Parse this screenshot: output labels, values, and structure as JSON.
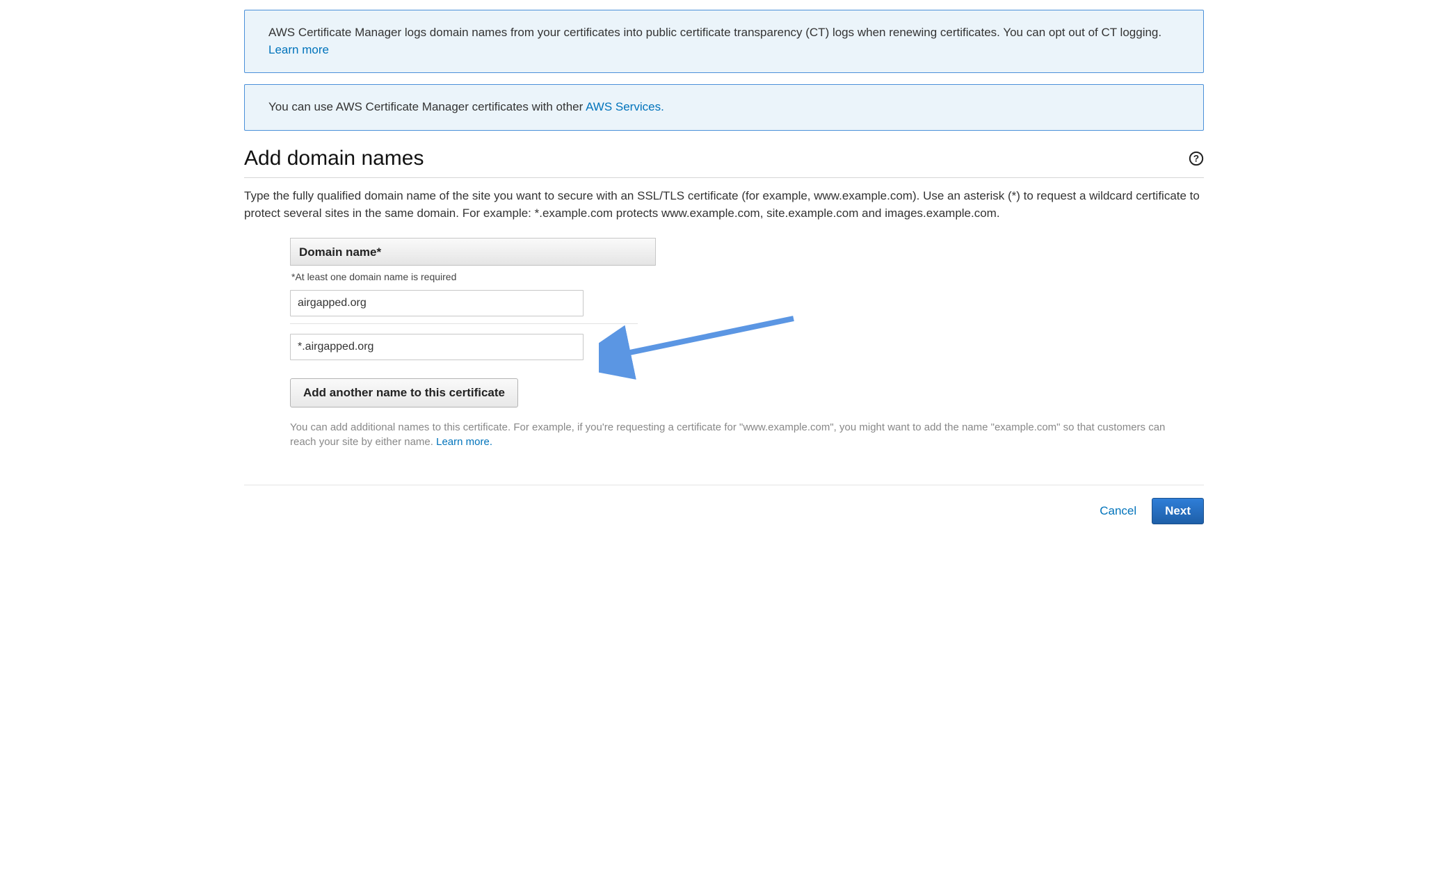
{
  "info1": {
    "text_before": "AWS Certificate Manager logs domain names from your certificates into public certificate transparency (CT) logs when renewing certificates. You can opt out of CT logging. ",
    "link": "Learn more"
  },
  "info2": {
    "text_before": "You can use AWS Certificate Manager certificates with other ",
    "link": "AWS Services."
  },
  "title": "Add domain names",
  "description": "Type the fully qualified domain name of the site you want to secure with an SSL/TLS certificate (for example, www.example.com). Use an asterisk (*) to request a wildcard certificate to protect several sites in the same domain. For example: *.example.com protects www.example.com, site.example.com and images.example.com.",
  "table": {
    "header": "Domain name*",
    "note": "*At least one domain name is required"
  },
  "domains": [
    "airgapped.org",
    "*.airgapped.org"
  ],
  "add_button": "Add another name to this certificate",
  "hint": {
    "text_before": "You can add additional names to this certificate. For example, if you're requesting a certificate for \"www.example.com\", you might want to add the name \"example.com\" so that customers can reach your site by either name. ",
    "link": "Learn more."
  },
  "footer": {
    "cancel": "Cancel",
    "next": "Next"
  }
}
